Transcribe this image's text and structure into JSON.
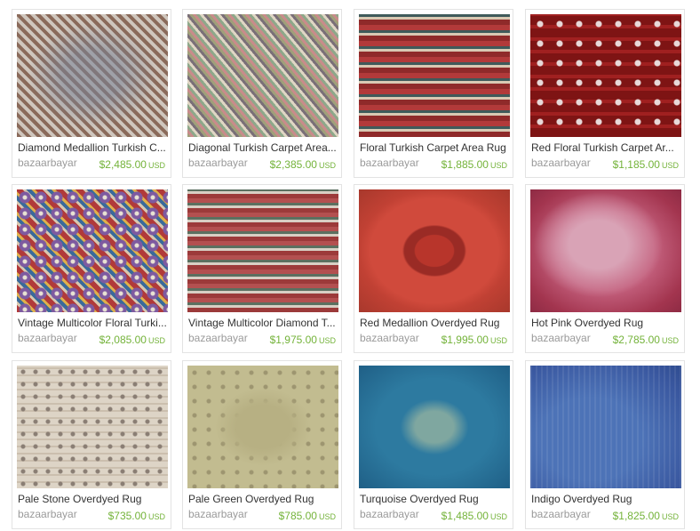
{
  "listings": [
    {
      "title": "Diamond Medallion Turkish C...",
      "shop": "bazaarbayar",
      "price": "$2,485.00",
      "currency": "USD",
      "image": "rug-diamond-medallion"
    },
    {
      "title": "Diagonal Turkish Carpet Area...",
      "shop": "bazaarbayar",
      "price": "$2,385.00",
      "currency": "USD",
      "image": "rug-diagonal"
    },
    {
      "title": "Floral Turkish Carpet Area Rug",
      "shop": "bazaarbayar",
      "price": "$1,885.00",
      "currency": "USD",
      "image": "rug-floral"
    },
    {
      "title": "Red Floral Turkish Carpet Ar...",
      "shop": "bazaarbayar",
      "price": "$1,185.00",
      "currency": "USD",
      "image": "rug-red-floral"
    },
    {
      "title": "Vintage Multicolor Floral Turki...",
      "shop": "bazaarbayar",
      "price": "$2,085.00",
      "currency": "USD",
      "image": "rug-vintage-multicolor-floral"
    },
    {
      "title": "Vintage Multicolor Diamond T...",
      "shop": "bazaarbayar",
      "price": "$1,975.00",
      "currency": "USD",
      "image": "rug-vintage-multicolor-diamond"
    },
    {
      "title": "Red Medallion Overdyed Rug",
      "shop": "bazaarbayar",
      "price": "$1,995.00",
      "currency": "USD",
      "image": "rug-red-medallion"
    },
    {
      "title": "Hot Pink Overdyed Rug",
      "shop": "bazaarbayar",
      "price": "$2,785.00",
      "currency": "USD",
      "image": "rug-hot-pink"
    },
    {
      "title": "Pale Stone Overdyed Rug",
      "shop": "bazaarbayar",
      "price": "$735.00",
      "currency": "USD",
      "image": "rug-pale-stone"
    },
    {
      "title": "Pale Green Overdyed Rug",
      "shop": "bazaarbayar",
      "price": "$785.00",
      "currency": "USD",
      "image": "rug-pale-green"
    },
    {
      "title": "Turquoise Overdyed Rug",
      "shop": "bazaarbayar",
      "price": "$1,485.00",
      "currency": "USD",
      "image": "rug-turquoise"
    },
    {
      "title": "Indigo Overdyed Rug",
      "shop": "bazaarbayar",
      "price": "$1,825.00",
      "currency": "USD",
      "image": "rug-indigo"
    }
  ],
  "colors": {
    "price": "#74b33a",
    "shop": "#9a9a9a",
    "title": "#333333",
    "border": "#e3e3e3"
  }
}
